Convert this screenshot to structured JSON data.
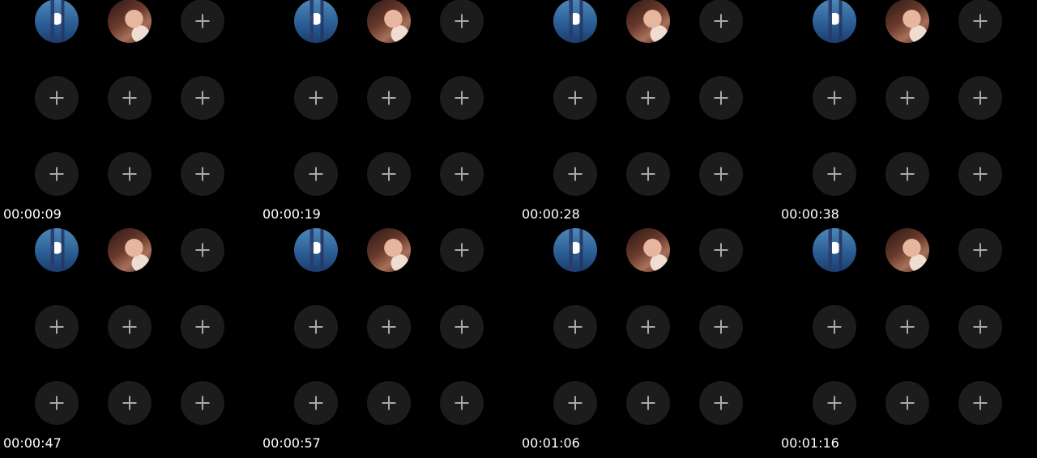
{
  "frames": [
    {
      "timestamp": "00:00:09"
    },
    {
      "timestamp": "00:00:19"
    },
    {
      "timestamp": "00:00:28"
    },
    {
      "timestamp": "00:00:38"
    },
    {
      "timestamp": "00:00:47"
    },
    {
      "timestamp": "00:00:57"
    },
    {
      "timestamp": "00:01:06"
    },
    {
      "timestamp": "00:01:16"
    }
  ],
  "grid": {
    "slots": [
      {
        "type": "avatar",
        "name": "avatar-person-blue"
      },
      {
        "type": "avatar",
        "name": "avatar-person-selfie"
      },
      {
        "type": "add",
        "icon": "plus-icon"
      },
      {
        "type": "add",
        "icon": "plus-icon"
      },
      {
        "type": "add",
        "icon": "plus-icon"
      },
      {
        "type": "add",
        "icon": "plus-icon"
      },
      {
        "type": "add",
        "icon": "plus-icon"
      },
      {
        "type": "add",
        "icon": "plus-icon"
      },
      {
        "type": "add",
        "icon": "plus-icon"
      }
    ]
  },
  "colors": {
    "background": "#000000",
    "slot_background": "#1c1c1c",
    "plus_icon": "#a9a9a9",
    "timestamp_text": "#ffffff"
  }
}
